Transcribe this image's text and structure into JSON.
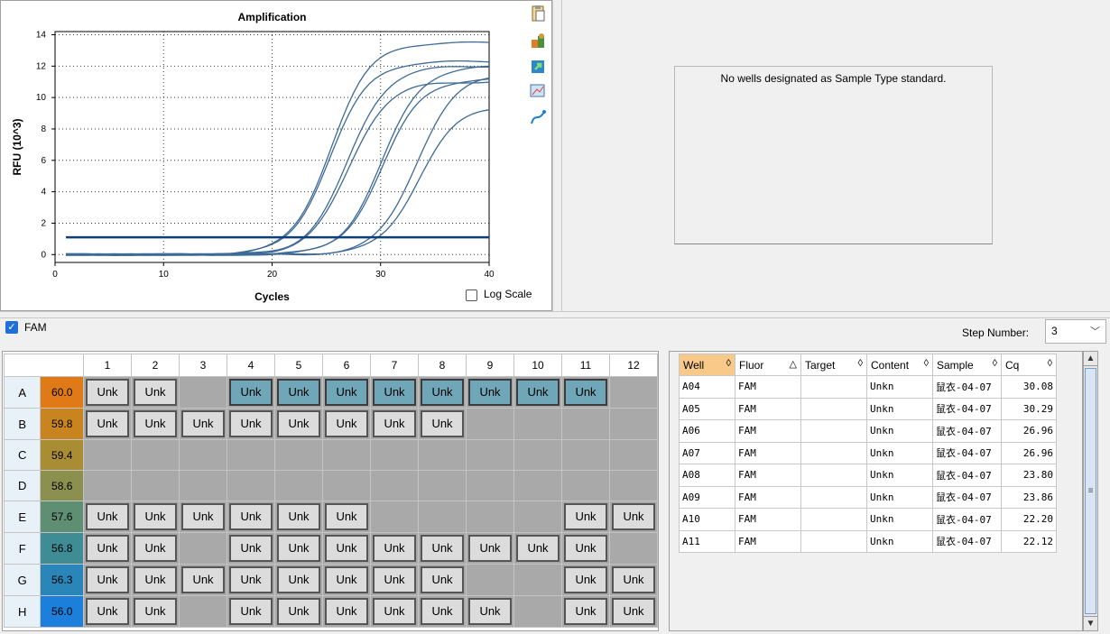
{
  "chart_data": {
    "type": "line",
    "title": "Amplification",
    "xlabel": "Cycles",
    "ylabel": "RFU (10^3)",
    "xlim": [
      0,
      40
    ],
    "ylim": [
      -0.5,
      14.2
    ],
    "xticks": [
      0,
      10,
      20,
      30,
      40
    ],
    "yticks": [
      0,
      2,
      4,
      6,
      8,
      10,
      12,
      14
    ],
    "grid": true,
    "threshold": 1.1,
    "series": [
      {
        "ct": 22.2,
        "plateau": 13.5
      },
      {
        "ct": 22.12,
        "plateau": 12.3
      },
      {
        "ct": 23.8,
        "plateau": 12.0
      },
      {
        "ct": 23.86,
        "plateau": 11.0
      },
      {
        "ct": 26.96,
        "plateau": 11.2
      },
      {
        "ct": 26.96,
        "plateau": 12.0
      },
      {
        "ct": 30.08,
        "plateau": 11.5
      },
      {
        "ct": 30.29,
        "plateau": 9.5
      }
    ]
  },
  "chart_ui": {
    "log_scale_label": "Log Scale"
  },
  "standard": {
    "message": "No wells designated as Sample Type standard."
  },
  "fluor": {
    "label": "FAM",
    "checked": true
  },
  "step": {
    "label": "Step Number:",
    "value": "3"
  },
  "plate": {
    "columns": [
      "1",
      "2",
      "3",
      "4",
      "5",
      "6",
      "7",
      "8",
      "9",
      "10",
      "11",
      "12"
    ],
    "rows": [
      {
        "label": "A",
        "temp": "60.0",
        "color": "#e07a16",
        "wells": [
          "Unk",
          "Unk",
          "",
          "Unk",
          "Unk",
          "Unk",
          "Unk",
          "Unk",
          "Unk",
          "Unk",
          "Unk",
          ""
        ],
        "selected": [
          false,
          false,
          false,
          true,
          true,
          true,
          true,
          true,
          true,
          true,
          true,
          false
        ]
      },
      {
        "label": "B",
        "temp": "59.8",
        "color": "#c9841f",
        "wells": [
          "Unk",
          "Unk",
          "Unk",
          "Unk",
          "Unk",
          "Unk",
          "Unk",
          "Unk",
          "",
          "",
          "",
          ""
        ],
        "selected": []
      },
      {
        "label": "C",
        "temp": "59.4",
        "color": "#a98d35",
        "wells": [
          "",
          "",
          "",
          "",
          "",
          "",
          "",
          "",
          "",
          "",
          "",
          ""
        ],
        "selected": []
      },
      {
        "label": "D",
        "temp": "58.6",
        "color": "#8c904f",
        "wells": [
          "",
          "",
          "",
          "",
          "",
          "",
          "",
          "",
          "",
          "",
          "",
          ""
        ],
        "selected": []
      },
      {
        "label": "E",
        "temp": "57.6",
        "color": "#5e8f72",
        "wells": [
          "Unk",
          "Unk",
          "Unk",
          "Unk",
          "Unk",
          "Unk",
          "",
          "",
          "",
          "",
          "Unk",
          "Unk"
        ],
        "selected": []
      },
      {
        "label": "F",
        "temp": "56.8",
        "color": "#3f8c95",
        "wells": [
          "Unk",
          "Unk",
          "",
          "Unk",
          "Unk",
          "Unk",
          "Unk",
          "Unk",
          "Unk",
          "Unk",
          "Unk",
          ""
        ],
        "selected": []
      },
      {
        "label": "G",
        "temp": "56.3",
        "color": "#2a86b8",
        "wells": [
          "Unk",
          "Unk",
          "Unk",
          "Unk",
          "Unk",
          "Unk",
          "Unk",
          "Unk",
          "",
          "",
          "Unk",
          "Unk"
        ],
        "selected": []
      },
      {
        "label": "H",
        "temp": "56.0",
        "color": "#1b7fdb",
        "wells": [
          "Unk",
          "Unk",
          "",
          "Unk",
          "Unk",
          "Unk",
          "Unk",
          "Unk",
          "Unk",
          "",
          "Unk",
          "Unk"
        ],
        "selected": []
      }
    ]
  },
  "grid": {
    "headers": [
      {
        "label": "Well",
        "sort": "◊",
        "active": true,
        "width": 62
      },
      {
        "label": "Fluor",
        "sort": "△",
        "active": false,
        "width": 73
      },
      {
        "label": "Target",
        "sort": "◊",
        "active": false,
        "width": 73
      },
      {
        "label": "Content",
        "sort": "◊",
        "active": false,
        "width": 73
      },
      {
        "label": "Sample",
        "sort": "◊",
        "active": false,
        "width": 76
      },
      {
        "label": "Cq",
        "sort": "◊",
        "active": false,
        "width": 61
      }
    ],
    "rows": [
      [
        "A04",
        "FAM",
        "",
        "Unkn",
        "鼠衣-04-07",
        "30.08"
      ],
      [
        "A05",
        "FAM",
        "",
        "Unkn",
        "鼠衣-04-07",
        "30.29"
      ],
      [
        "A06",
        "FAM",
        "",
        "Unkn",
        "鼠衣-04-07",
        "26.96"
      ],
      [
        "A07",
        "FAM",
        "",
        "Unkn",
        "鼠衣-04-07",
        "26.96"
      ],
      [
        "A08",
        "FAM",
        "",
        "Unkn",
        "鼠衣-04-07",
        "23.80"
      ],
      [
        "A09",
        "FAM",
        "",
        "Unkn",
        "鼠衣-04-07",
        "23.86"
      ],
      [
        "A10",
        "FAM",
        "",
        "Unkn",
        "鼠衣-04-07",
        "22.20"
      ],
      [
        "A11",
        "FAM",
        "",
        "Unkn",
        "鼠衣-04-07",
        "22.12"
      ]
    ]
  },
  "tools": [
    "clipboard-icon",
    "settings-icon",
    "export-icon",
    "zoom-chart-icon",
    "trace-style-icon"
  ]
}
